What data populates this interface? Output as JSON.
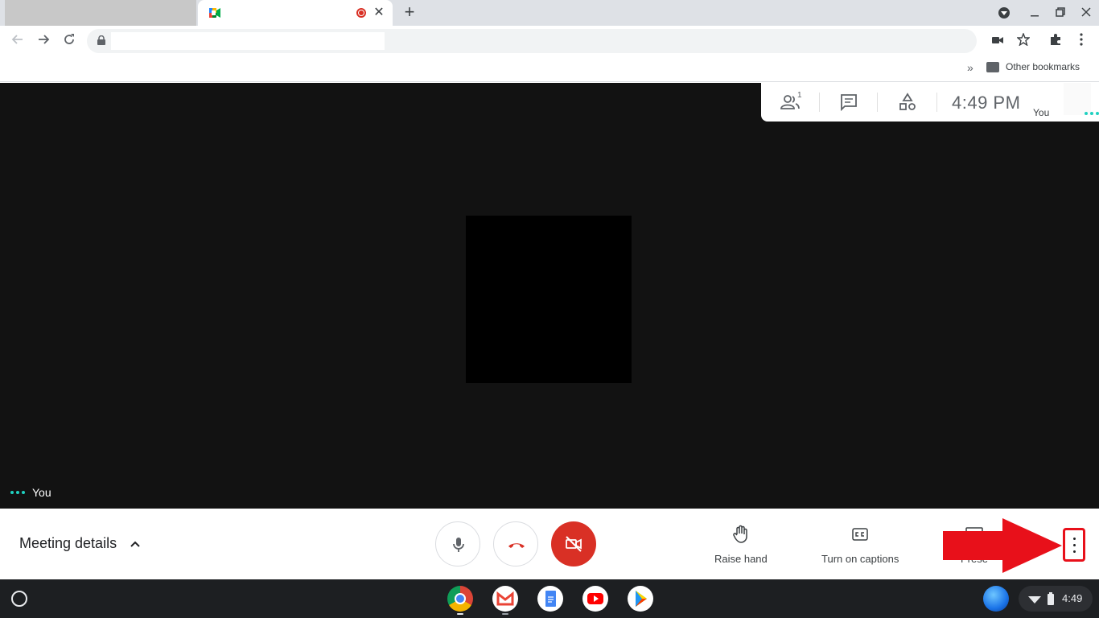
{
  "browser": {
    "active_tab_title": "",
    "bookmarks": {
      "overflow_label": "»",
      "folder_label": "Other bookmarks"
    },
    "url": ""
  },
  "meeting": {
    "clock": "4:49  PM",
    "participants_count": "1",
    "self_name_panel": "You",
    "self_name_tile": "You",
    "details_label": "Meeting details",
    "actions": [
      {
        "label": "Raise hand"
      },
      {
        "label": "Turn on captions"
      }
    ],
    "hidden_action_fragment": "Prese"
  },
  "system": {
    "time": "4:49"
  },
  "colors": {
    "stage_bg": "#121212",
    "danger": "#d93025",
    "accent_dots": "#1fd1c1",
    "annotation_red": "#e8101a"
  }
}
